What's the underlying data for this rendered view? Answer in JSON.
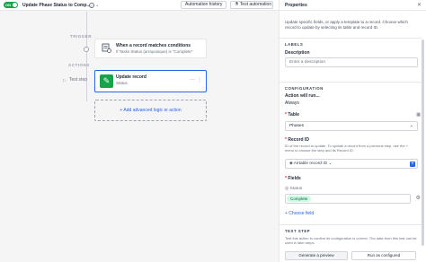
{
  "topbar": {
    "toggle_label": "ON",
    "automation_title": "Update Phase Status to Comp...",
    "history_button": "Automation history",
    "test_button": "Test automation"
  },
  "canvas": {
    "trigger_label": "TRIGGER",
    "actions_label": "ACTIONS",
    "test_step_label": "Test step",
    "trigger_card": {
      "title": "When a record matches conditions",
      "subtitle": "If Tasks Status (arrayunique) is \"Complete\""
    },
    "action_card": {
      "title": "Update record",
      "subtitle": "Status"
    },
    "add_logic": "+ Add advanced logic or action"
  },
  "panel": {
    "title": "Properties",
    "description": "Update specific fields, or apply a template to a record. Choose which record to update by selecting its table and record ID.",
    "labels_section": "LABELS",
    "description_label": "Description",
    "description_placeholder": "Enter a description",
    "configuration_section": "CONFIGURATION",
    "action_will_run_label": "Action will run...",
    "action_will_run_value": "Always",
    "table_label": "Table",
    "table_value": "Phases",
    "record_id_label": "Record ID",
    "record_id_help": "ID of the record to update. To update a record from a previous step, use the + menu to choose the step and its Record ID.",
    "record_id_token": "Airtable record ID",
    "fields_label": "Fields",
    "field_status_label": "Status",
    "field_status_value": "Complete",
    "choose_field": "+ Choose field",
    "test_step_section": "TEST STEP",
    "test_step_help": "Test this action to confirm its configuration is correct. The data from this test can be used in later steps.",
    "generate_button": "Generate a preview",
    "run_button": "Run as configured"
  },
  "colors": {
    "accent": "#2563eb",
    "toggle_on": "#16a34a",
    "action_icon_bg": "#16a34a",
    "badge_bg": "#d1fae5"
  },
  "icons": {
    "trigger_icon": "record-conditions-icon",
    "action_icon": "pencil-icon",
    "info": "info-icon",
    "play": "play-icon"
  }
}
